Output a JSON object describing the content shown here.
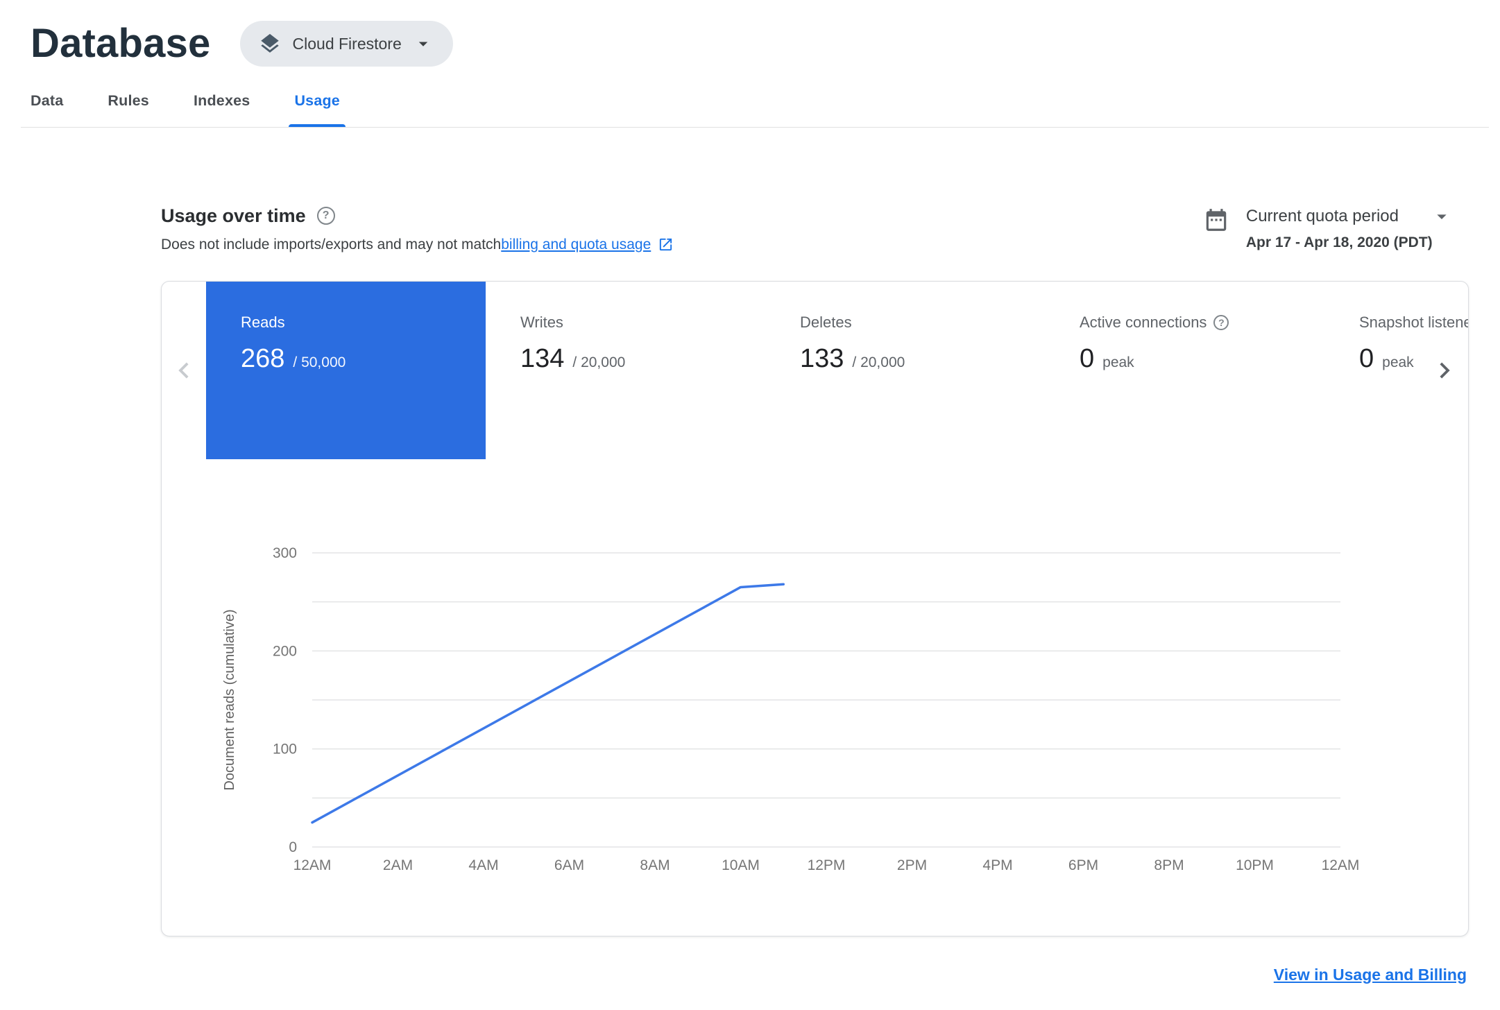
{
  "colors": {
    "accent": "#1a73e8",
    "selected_tile": "#2b6de0",
    "chart_line": "#3d79e8",
    "title": "#22303c"
  },
  "header": {
    "title": "Database",
    "product_selector": {
      "label": "Cloud Firestore"
    }
  },
  "tabs": [
    {
      "label": "Data"
    },
    {
      "label": "Rules"
    },
    {
      "label": "Indexes"
    },
    {
      "label": "Usage",
      "active": true
    }
  ],
  "usage_section": {
    "title": "Usage over time",
    "subtitle_prefix": "Does not include imports/exports and may not match ",
    "subtitle_link_text": "billing and quota usage",
    "quota_period": {
      "label": "Current quota period",
      "range": "Apr 17 - Apr 18, 2020 (PDT)"
    }
  },
  "metrics": [
    {
      "label": "Reads",
      "value": "268",
      "suffix": "/ 50,000",
      "selected": true
    },
    {
      "label": "Writes",
      "value": "134",
      "suffix": "/ 20,000"
    },
    {
      "label": "Deletes",
      "value": "133",
      "suffix": "/ 20,000"
    },
    {
      "label": "Active connections",
      "value": "0",
      "suffix": "peak",
      "help": true
    },
    {
      "label": "Snapshot listeners",
      "value": "0",
      "suffix": "peak"
    }
  ],
  "footer": {
    "link_label": "View in Usage and Billing"
  },
  "chart_data": {
    "type": "line",
    "title": "",
    "xlabel": "",
    "ylabel": "Document reads (cumulative)",
    "x_tick_labels": [
      "12AM",
      "2AM",
      "4AM",
      "6AM",
      "8AM",
      "10AM",
      "12PM",
      "2PM",
      "4PM",
      "6PM",
      "8PM",
      "10PM",
      "12AM"
    ],
    "x_tick_hours": [
      0,
      2,
      4,
      6,
      8,
      10,
      12,
      14,
      16,
      18,
      20,
      22,
      24
    ],
    "y_ticks": [
      0,
      100,
      200,
      300
    ],
    "ylim": [
      0,
      300
    ],
    "xlim_hours": [
      0,
      24
    ],
    "grid": true,
    "grid_interval": 50,
    "legend": "none",
    "series": [
      {
        "name": "Document reads (cumulative)",
        "points": [
          [
            0,
            25
          ],
          [
            10,
            265
          ],
          [
            11,
            268
          ]
        ]
      }
    ]
  }
}
